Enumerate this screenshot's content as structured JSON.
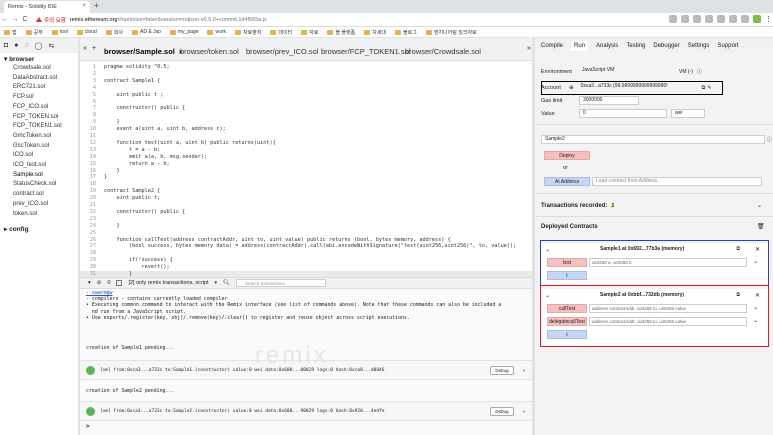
{
  "browser": {
    "tab_title": "Remix - Solidity IDE",
    "tab_close": "×",
    "new_tab": "+",
    "back": "←",
    "forward": "→",
    "reload": "C",
    "home": "⌂",
    "security_label": "주의 요함",
    "url_host": "remix.ethereum.org",
    "url_rest": "/#optimize=false&version=soljson-v0.5.0+commit.1d4f565a.js",
    "bookmarks": [
      "앱",
      "공부",
      "tool",
      "cloud",
      "회사",
      "AD & Jsp",
      "my_page",
      "work",
      "자료출처",
      "데이터",
      "자료",
      "블 플랫폼",
      "차세대",
      "블로그",
      "엔지니어링 징크자료"
    ]
  },
  "remix": {
    "fe_icons": [
      "◘",
      "●",
      "◌",
      "◯",
      "⇆"
    ],
    "tree": {
      "root": "browser",
      "files": [
        "Crowdsale.sol",
        "DataAbstract.sol",
        "ERC721.sol",
        "FCP.sol",
        "FCP_ICO.sol",
        "FCP_TOKEN.sol",
        "FCP_TOKEN1.sol",
        "GmcToken.sol",
        "GscToken.sol",
        "ICO.sol",
        "ICO_test.sol",
        "Sample.sol",
        "StatusCheck.sol",
        "contract.sol",
        "prev_ICO.sol",
        "token.sol"
      ],
      "config": "config"
    },
    "editor_tabs": [
      "browser/Sample.sol",
      "browser/token.sol",
      "browser/prev_ICO.sol",
      "browser/FCP_TOKEN1.sol",
      "browser/Crowdsale.sol"
    ],
    "tab_nav_left": "«",
    "tab_nav_plus": "+",
    "tab_close": "×",
    "tab_nav_right": "»",
    "code_lines": [
      {
        "n": "1",
        "t": "pragma solidity ^0.5;"
      },
      {
        "n": "2",
        "t": ""
      },
      {
        "n": "3",
        "t": "contract Sample1 {"
      },
      {
        "n": "4",
        "t": ""
      },
      {
        "n": "5",
        "t": "    uint public t ;"
      },
      {
        "n": "6",
        "t": ""
      },
      {
        "n": "7",
        "t": "    constructor() public {"
      },
      {
        "n": "8",
        "t": ""
      },
      {
        "n": "9",
        "t": "    }"
      },
      {
        "n": "10",
        "t": "    event a(uint a, uint b, address c);"
      },
      {
        "n": "11",
        "t": ""
      },
      {
        "n": "12",
        "t": "    function test(uint a, uint b) public returns(uint){"
      },
      {
        "n": "13",
        "t": "        t = a - b;"
      },
      {
        "n": "14",
        "t": "        emit a(a, b, msg.sender);"
      },
      {
        "n": "15",
        "t": "        return a - b;"
      },
      {
        "n": "16",
        "t": "    }"
      },
      {
        "n": "17",
        "t": "}"
      },
      {
        "n": "18",
        "t": ""
      },
      {
        "n": "19",
        "t": "contract Sample2 {"
      },
      {
        "n": "20",
        "t": "    uint public t;"
      },
      {
        "n": "21",
        "t": ""
      },
      {
        "n": "22",
        "t": "    constructor() public {"
      },
      {
        "n": "23",
        "t": ""
      },
      {
        "n": "24",
        "t": "    }"
      },
      {
        "n": "25",
        "t": ""
      },
      {
        "n": "26",
        "t": "    function callTest(address contractAddr, uint to, uint value) public returns (bool, bytes memory, address) {"
      },
      {
        "n": "27",
        "t": "        (bool success, bytes memory data) = address(contractAddr).call(abi.encodeWithSignature(\"test(uint256,uint256)\", to, value));"
      },
      {
        "n": "28",
        "t": ""
      },
      {
        "n": "29",
        "t": "        if(!success) {"
      },
      {
        "n": "30",
        "t": "            revert();"
      },
      {
        "n": "31",
        "t": "        }"
      }
    ],
    "terminal": {
      "bar_toggle": "▾",
      "bar_clear": "⊘",
      "bar_count": "0",
      "bar_filter": "[2] only remix transactions, script",
      "search_placeholder": "Search transactions",
      "lines": [
        "- swarmgw",
        "- compilers - contains currently loaded compiler",
        "• Executing common command to interact with the Remix interface (see list of commands above). Note that these commands can also be included a",
        "  nd run from a JavaScript script.",
        "• Use exports/.register(key, obj)/.remove(key)/.clear() to register and reuse object across script executions."
      ],
      "pending1": "creation of Sample1 pending...",
      "tx1": "[vm] from:0xca3...a733c to:Sample1.(constructor) value:0 wei data:0x608...00029 logs:0 hash:0xca8...d0846",
      "pending2": "creation of Sample2 pending...",
      "tx2": "[vm] from:0xca3...a733c to:Sample2.(constructor) value:0 wei data:0x608...90029 logs:0 hash:0x928...4edfe",
      "debug_label": "Debug",
      "chevron": "⌄",
      "prompt": ">",
      "watermark": "remix"
    },
    "right_tabs": [
      "Compile",
      "Run",
      "Analysis",
      "Testing",
      "Debugger",
      "Settings",
      "Support"
    ],
    "run": {
      "environment_label": "Environment",
      "environment_value": "JavaScript VM",
      "environment_vm": "VM (-)",
      "account_label": "Account",
      "account_value": "0xca3...a733c (99.9999999999999990!",
      "gas_label": "Gas limit",
      "gas_value": "3000000",
      "value_label": "Value",
      "value_value": "0",
      "value_unit": "wei",
      "contract_select": "Sample2",
      "deploy_label": "Deploy",
      "or_label": "or",
      "at_address_label": "At Address",
      "at_address_placeholder": "Load contract from Address",
      "tx_recorded_label": "Transactions recorded:",
      "tx_recorded_count": "2",
      "deployed_label": "Deployed Contracts",
      "instances": [
        {
          "title": "Sample1 at 0x692...77b3a (memory)",
          "functions": [
            {
              "name": "test",
              "placeholder": "uint256 a, uint256 b"
            }
          ],
          "extra_button": "t"
        },
        {
          "title": "Sample2 at 0xbbf...732db (memory)",
          "functions": [
            {
              "name": "callTest",
              "placeholder": "address contractAddr, uint256 to, uint256 value"
            },
            {
              "name": "delegatecallTest",
              "placeholder": "address contractAddr, uint256 to, uint256 value"
            }
          ],
          "extra_button": "t"
        }
      ]
    }
  }
}
